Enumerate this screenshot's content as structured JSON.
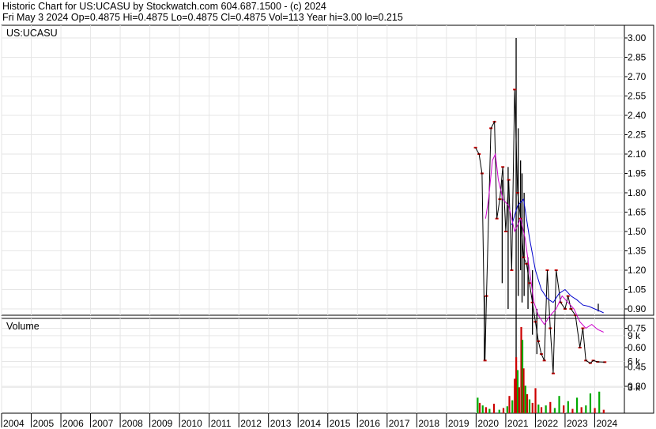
{
  "header": {
    "line1": "Historic Chart for US:UCASU by Stockwatch.com 604.687.1500 - (c) 2024",
    "line2": "Fri May  3 2024  Op=0.4875  Hi=0.4875  Lo=0.4875  Cl=0.4875  Vol=113  Year hi=3.00  lo=0.215"
  },
  "chart_data": [
    {
      "type": "line",
      "title": "US:UCASU",
      "xlabel": "",
      "ylabel": "",
      "ylim": [
        0.15,
        3.1
      ],
      "yticks": [
        "3.00",
        "2.85",
        "2.70",
        "2.55",
        "2.40",
        "2.25",
        "2.10",
        "1.95",
        "1.80",
        "1.65",
        "1.50",
        "1.35",
        "1.20",
        "1.05",
        "0.90",
        "0.75",
        "0.60",
        "0.45",
        "0.30"
      ],
      "xticks": [
        "2004",
        "2005",
        "2006",
        "2007",
        "2008",
        "2009",
        "2010",
        "2011",
        "2012",
        "2013",
        "2014",
        "2015",
        "2016",
        "2017",
        "2018",
        "2019",
        "2020",
        "2021",
        "2022",
        "2023",
        "2024"
      ],
      "grid": true,
      "price_points": [
        {
          "x": 2019.98,
          "y": 2.15
        },
        {
          "x": 2020.1,
          "y": 2.1
        },
        {
          "x": 2020.2,
          "y": 1.95
        },
        {
          "x": 2020.3,
          "y": 0.5
        },
        {
          "x": 2020.35,
          "y": 1.0
        },
        {
          "x": 2020.5,
          "y": 2.3
        },
        {
          "x": 2020.62,
          "y": 2.35
        },
        {
          "x": 2020.7,
          "y": 1.6
        },
        {
          "x": 2020.8,
          "y": 1.75
        },
        {
          "x": 2020.9,
          "y": 2.0
        },
        {
          "x": 2021.0,
          "y": 1.5
        },
        {
          "x": 2021.1,
          "y": 1.9
        },
        {
          "x": 2021.2,
          "y": 1.2
        },
        {
          "x": 2021.3,
          "y": 2.6
        },
        {
          "x": 2021.4,
          "y": 1.8
        },
        {
          "x": 2021.5,
          "y": 1.6
        },
        {
          "x": 2021.6,
          "y": 1.3
        },
        {
          "x": 2021.7,
          "y": 1.25
        },
        {
          "x": 2021.8,
          "y": 1.1
        },
        {
          "x": 2021.9,
          "y": 0.95
        },
        {
          "x": 2022.0,
          "y": 0.8
        },
        {
          "x": 2022.1,
          "y": 0.65
        },
        {
          "x": 2022.2,
          "y": 0.55
        },
        {
          "x": 2022.3,
          "y": 0.5
        },
        {
          "x": 2022.4,
          "y": 1.2
        },
        {
          "x": 2022.5,
          "y": 0.75
        },
        {
          "x": 2022.6,
          "y": 0.4
        },
        {
          "x": 2022.7,
          "y": 1.2
        },
        {
          "x": 2022.85,
          "y": 0.95
        },
        {
          "x": 2023.0,
          "y": 0.9
        },
        {
          "x": 2023.1,
          "y": 1.0
        },
        {
          "x": 2023.2,
          "y": 0.9
        },
        {
          "x": 2023.35,
          "y": 0.85
        },
        {
          "x": 2023.5,
          "y": 0.6
        },
        {
          "x": 2023.6,
          "y": 0.75
        },
        {
          "x": 2023.7,
          "y": 0.5
        },
        {
          "x": 2023.85,
          "y": 0.48
        },
        {
          "x": 2023.95,
          "y": 0.5
        },
        {
          "x": 2024.1,
          "y": 0.49
        },
        {
          "x": 2024.34,
          "y": 0.4875
        }
      ],
      "range_bars": [
        {
          "x": 2020.28,
          "low": 0.5,
          "high": 1.0
        },
        {
          "x": 2020.88,
          "low": 1.1,
          "high": 1.9
        },
        {
          "x": 2021.08,
          "low": 0.9,
          "high": 2.0
        },
        {
          "x": 2021.35,
          "low": 0.5,
          "high": 3.0
        },
        {
          "x": 2021.42,
          "low": 1.0,
          "high": 2.3
        },
        {
          "x": 2021.5,
          "low": 1.2,
          "high": 2.05
        },
        {
          "x": 2021.55,
          "low": 0.95,
          "high": 1.95
        },
        {
          "x": 2021.62,
          "low": 1.0,
          "high": 1.8
        },
        {
          "x": 2021.75,
          "low": 0.9,
          "high": 1.3
        },
        {
          "x": 2021.9,
          "low": 0.7,
          "high": 1.2
        },
        {
          "x": 2022.05,
          "low": 0.55,
          "high": 0.9
        },
        {
          "x": 2024.12,
          "low": 0.88,
          "high": 0.94
        }
      ],
      "series": [
        {
          "color": "#0000cc",
          "points": [
            {
              "x": 2021.2,
              "y": 1.55
            },
            {
              "x": 2021.4,
              "y": 1.7
            },
            {
              "x": 2021.6,
              "y": 1.75
            },
            {
              "x": 2021.8,
              "y": 1.45
            },
            {
              "x": 2022.0,
              "y": 1.2
            },
            {
              "x": 2022.2,
              "y": 1.05
            },
            {
              "x": 2022.4,
              "y": 0.98
            },
            {
              "x": 2022.6,
              "y": 0.95
            },
            {
              "x": 2022.8,
              "y": 1.02
            },
            {
              "x": 2023.0,
              "y": 1.05
            },
            {
              "x": 2023.2,
              "y": 1.0
            },
            {
              "x": 2023.4,
              "y": 0.97
            },
            {
              "x": 2023.6,
              "y": 0.93
            },
            {
              "x": 2023.8,
              "y": 0.92
            },
            {
              "x": 2024.0,
              "y": 0.9
            },
            {
              "x": 2024.3,
              "y": 0.87
            }
          ]
        },
        {
          "color": "#cc00cc",
          "points": [
            {
              "x": 2020.32,
              "y": 1.6
            },
            {
              "x": 2020.42,
              "y": 1.75
            },
            {
              "x": 2020.55,
              "y": 2.05
            },
            {
              "x": 2020.65,
              "y": 2.1
            },
            {
              "x": 2020.75,
              "y": 1.9
            },
            {
              "x": 2020.9,
              "y": 1.75
            },
            {
              "x": 2021.1,
              "y": 1.7
            },
            {
              "x": 2021.3,
              "y": 1.5
            },
            {
              "x": 2021.5,
              "y": 1.6
            },
            {
              "x": 2021.65,
              "y": 1.45
            },
            {
              "x": 2021.8,
              "y": 1.2
            },
            {
              "x": 2021.95,
              "y": 0.95
            },
            {
              "x": 2022.1,
              "y": 0.85
            },
            {
              "x": 2022.3,
              "y": 0.78
            },
            {
              "x": 2022.5,
              "y": 0.85
            },
            {
              "x": 2022.7,
              "y": 0.9
            },
            {
              "x": 2022.9,
              "y": 1.0
            },
            {
              "x": 2023.1,
              "y": 0.95
            },
            {
              "x": 2023.3,
              "y": 0.9
            },
            {
              "x": 2023.5,
              "y": 0.8
            },
            {
              "x": 2023.7,
              "y": 0.75
            },
            {
              "x": 2023.9,
              "y": 0.78
            },
            {
              "x": 2024.1,
              "y": 0.74
            },
            {
              "x": 2024.3,
              "y": 0.72
            }
          ]
        }
      ]
    },
    {
      "type": "bar",
      "title": "Volume",
      "ylim": [
        0,
        11000
      ],
      "yticks": [
        "9 k",
        "6 k",
        "3 k"
      ],
      "bars": [
        {
          "x": 2020.05,
          "v": 1800,
          "c": "#00aa00"
        },
        {
          "x": 2020.12,
          "v": 1200,
          "c": "#cc0000"
        },
        {
          "x": 2020.22,
          "v": 900,
          "c": "#00aa00"
        },
        {
          "x": 2020.33,
          "v": 700,
          "c": "#cc0000"
        },
        {
          "x": 2020.45,
          "v": 500,
          "c": "#00aa00"
        },
        {
          "x": 2020.6,
          "v": 1100,
          "c": "#cc0000"
        },
        {
          "x": 2020.78,
          "v": 400,
          "c": "#00aa00"
        },
        {
          "x": 2020.92,
          "v": 600,
          "c": "#cc0000"
        },
        {
          "x": 2021.05,
          "v": 800,
          "c": "#00aa00"
        },
        {
          "x": 2021.12,
          "v": 2000,
          "c": "#cc0000"
        },
        {
          "x": 2021.22,
          "v": 1500,
          "c": "#00aa00"
        },
        {
          "x": 2021.3,
          "v": 4000,
          "c": "#cc0000"
        },
        {
          "x": 2021.35,
          "v": 6500,
          "c": "#cc0000"
        },
        {
          "x": 2021.4,
          "v": 5000,
          "c": "#00aa00"
        },
        {
          "x": 2021.45,
          "v": 3000,
          "c": "#cc0000"
        },
        {
          "x": 2021.52,
          "v": 10000,
          "c": "#cc0000"
        },
        {
          "x": 2021.56,
          "v": 8500,
          "c": "#00aa00"
        },
        {
          "x": 2021.6,
          "v": 5200,
          "c": "#cc0000"
        },
        {
          "x": 2021.66,
          "v": 3200,
          "c": "#00aa00"
        },
        {
          "x": 2021.72,
          "v": 2200,
          "c": "#cc0000"
        },
        {
          "x": 2021.8,
          "v": 1600,
          "c": "#00aa00"
        },
        {
          "x": 2021.9,
          "v": 1200,
          "c": "#cc0000"
        },
        {
          "x": 2022.0,
          "v": 2900,
          "c": "#cc0000"
        },
        {
          "x": 2022.1,
          "v": 1000,
          "c": "#00aa00"
        },
        {
          "x": 2022.2,
          "v": 700,
          "c": "#cc0000"
        },
        {
          "x": 2022.35,
          "v": 900,
          "c": "#00aa00"
        },
        {
          "x": 2022.5,
          "v": 1300,
          "c": "#cc0000"
        },
        {
          "x": 2022.65,
          "v": 600,
          "c": "#00aa00"
        },
        {
          "x": 2022.8,
          "v": 2000,
          "c": "#00aa00"
        },
        {
          "x": 2022.95,
          "v": 900,
          "c": "#cc0000"
        },
        {
          "x": 2023.1,
          "v": 1400,
          "c": "#00aa00"
        },
        {
          "x": 2023.25,
          "v": 500,
          "c": "#cc0000"
        },
        {
          "x": 2023.4,
          "v": 1800,
          "c": "#00aa00"
        },
        {
          "x": 2023.55,
          "v": 700,
          "c": "#cc0000"
        },
        {
          "x": 2023.7,
          "v": 900,
          "c": "#00aa00"
        },
        {
          "x": 2023.85,
          "v": 2300,
          "c": "#00aa00"
        },
        {
          "x": 2024.0,
          "v": 600,
          "c": "#cc0000"
        },
        {
          "x": 2024.15,
          "v": 2500,
          "c": "#00aa00"
        },
        {
          "x": 2024.3,
          "v": 400,
          "c": "#cc0000"
        }
      ]
    }
  ],
  "colors": {
    "price": "#000000",
    "price_dots": "#cc0000",
    "ma_short": "#0000cc",
    "ma_long": "#cc00cc",
    "volume_up": "#00aa00",
    "volume_down": "#cc0000",
    "grid": "#e6e6e6"
  }
}
